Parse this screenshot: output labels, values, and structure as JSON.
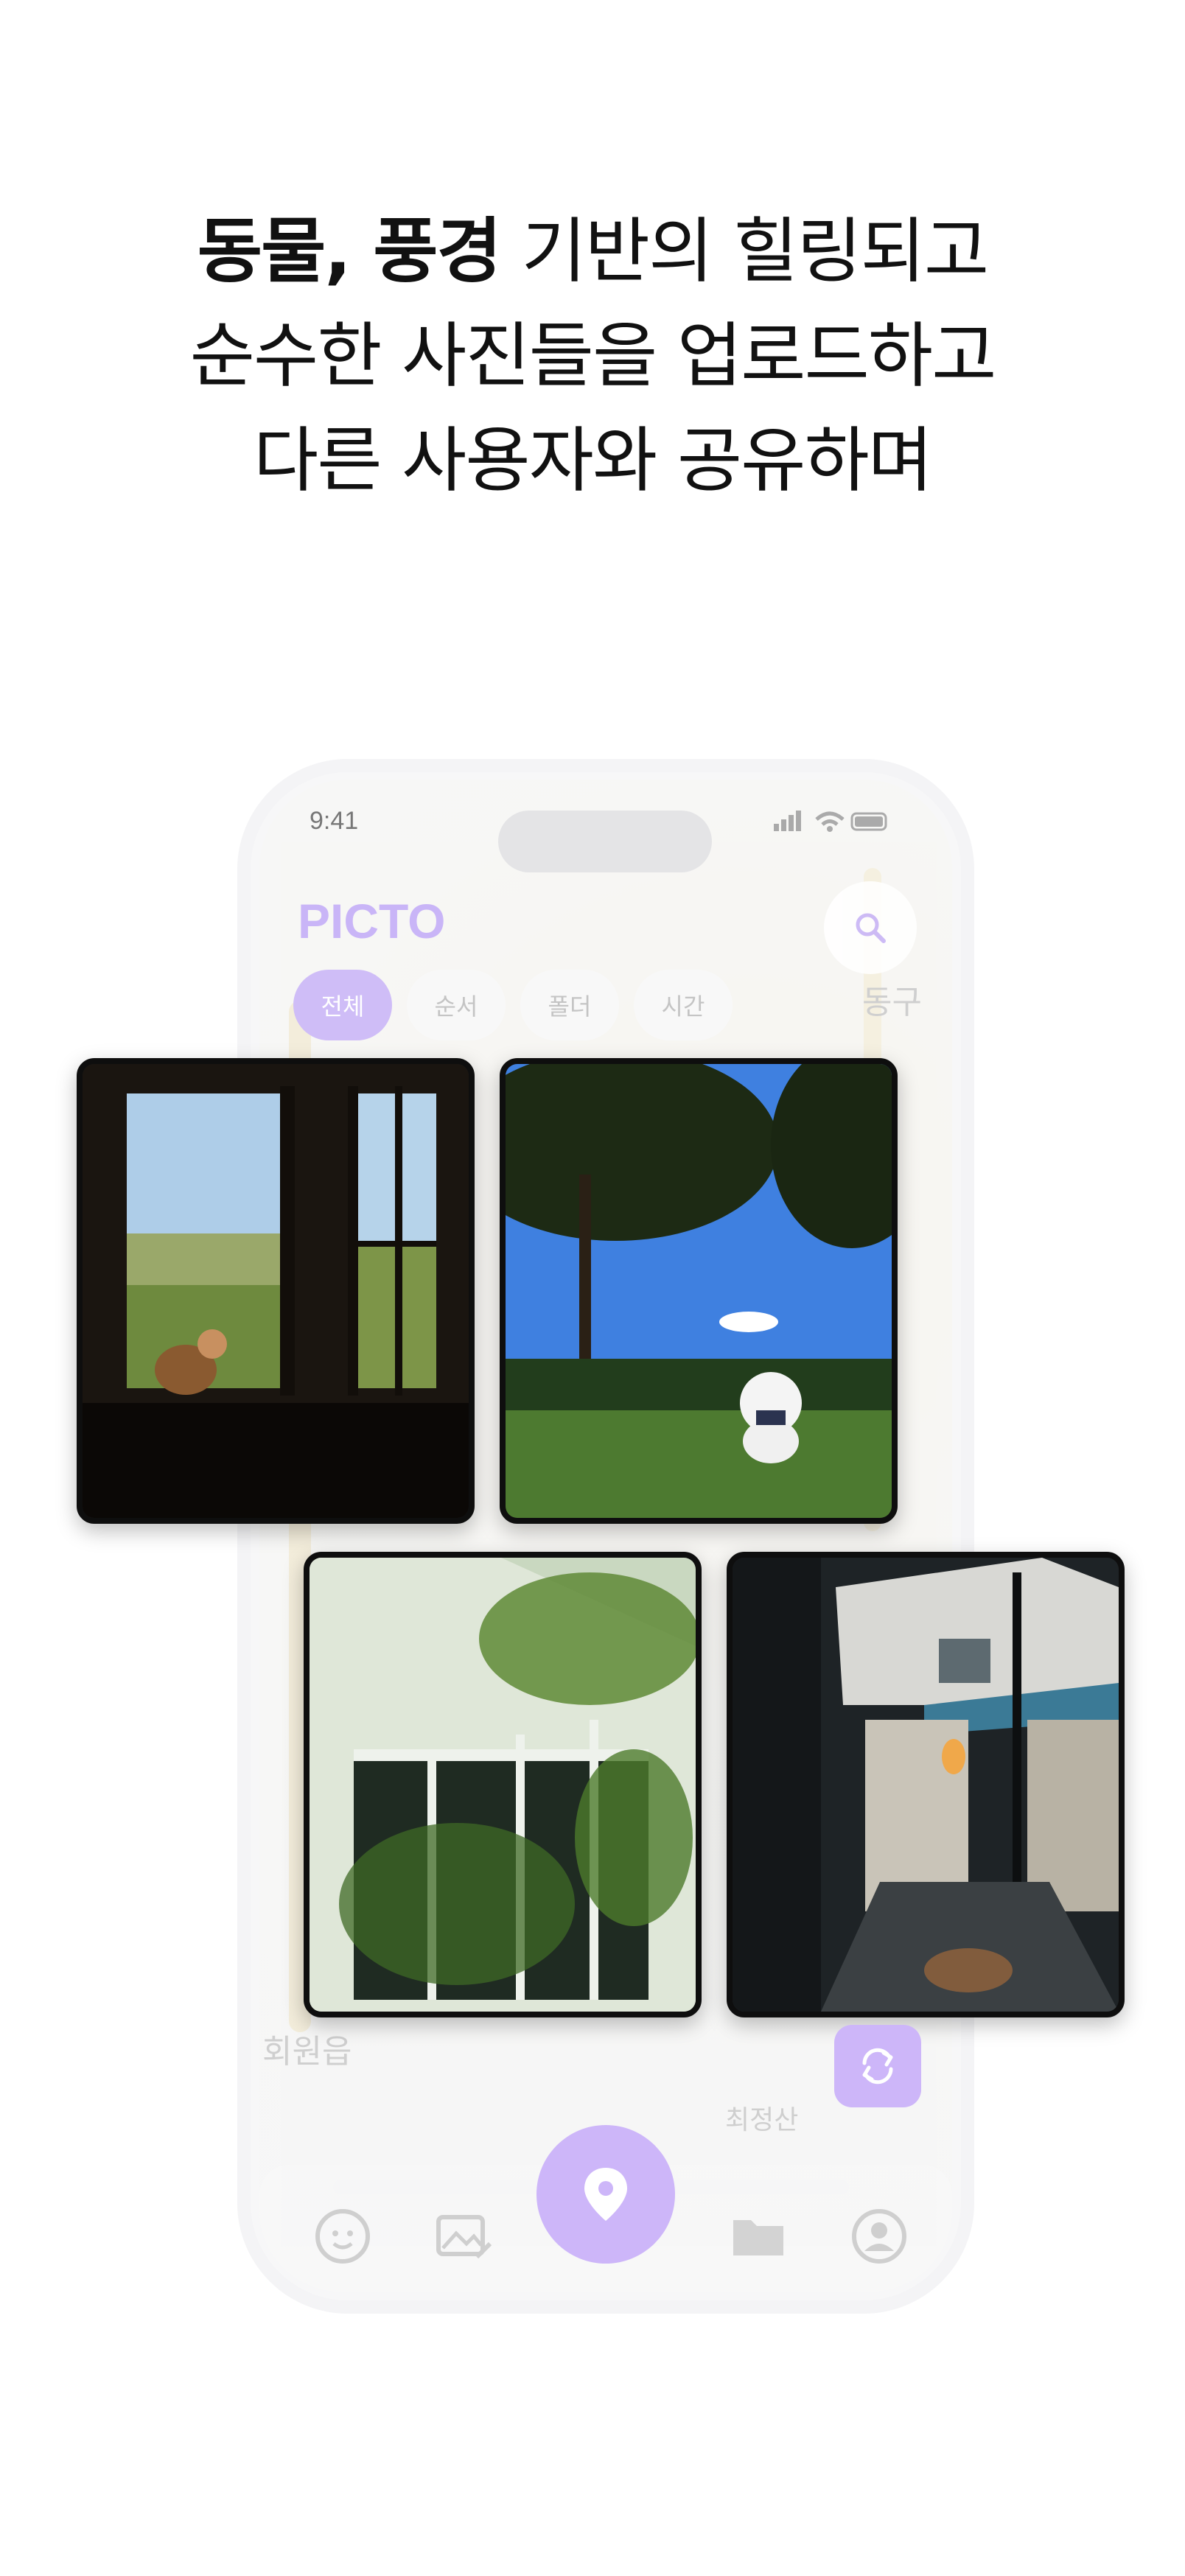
{
  "headline": {
    "line1_bold": "동물, 풍경",
    "line1_rest": " 기반의 힐링되고",
    "line2": "순수한 사진들을 업로드하고",
    "line3": "다른 사용자와 공유하며"
  },
  "status_bar": {
    "time": "9:41"
  },
  "app": {
    "logo": "PICTO",
    "filters": [
      {
        "label": "전체",
        "active": true
      },
      {
        "label": "순서",
        "active": false
      },
      {
        "label": "폴더",
        "active": false
      },
      {
        "label": "시간",
        "active": false
      }
    ]
  },
  "map_labels": [
    "동구",
    "회원읍",
    "최정산"
  ],
  "photos": [
    {
      "subject": "cat at window"
    },
    {
      "subject": "white dog on lawn"
    },
    {
      "subject": "building window with leaves"
    },
    {
      "subject": "alley at night"
    }
  ],
  "icons": {
    "search": "search-icon",
    "refresh": "refresh-icon",
    "nav": [
      "face-icon",
      "photo-edit-icon",
      "location-pin-icon",
      "folder-icon",
      "profile-icon"
    ]
  },
  "colors": {
    "accent": "#cdb6f9",
    "text": "#111111"
  }
}
